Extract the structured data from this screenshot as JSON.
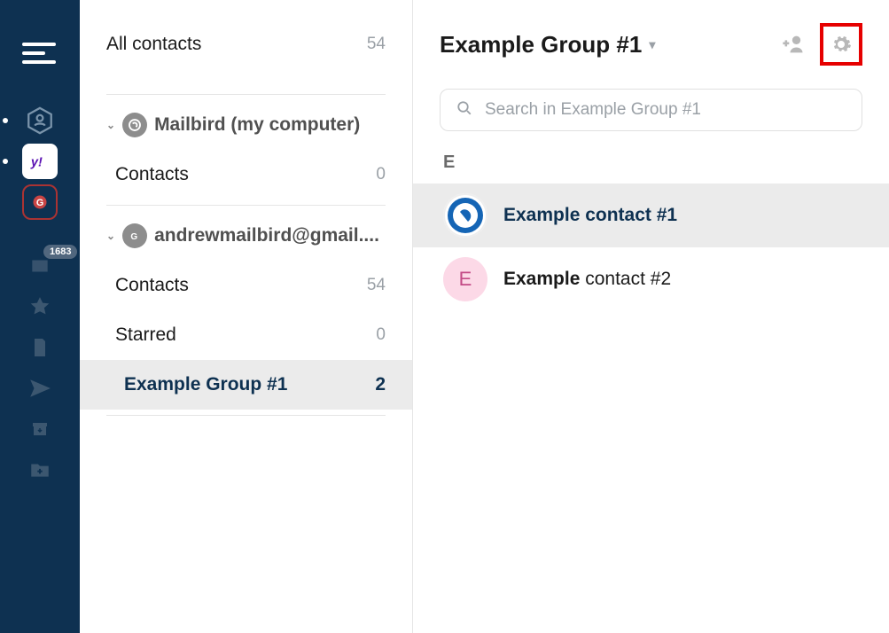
{
  "rail": {
    "badge_count": "1683"
  },
  "sidebar": {
    "all_contacts_label": "All contacts",
    "all_contacts_count": "54",
    "accounts": [
      {
        "name": "Mailbird (my computer)",
        "contacts_label": "Contacts",
        "contacts_count": "0"
      },
      {
        "name": "andrewmailbird@gmail....",
        "contacts_label": "Contacts",
        "contacts_count": "54",
        "starred_label": "Starred",
        "starred_count": "0",
        "group_label": "Example Group #1",
        "group_count": "2"
      }
    ]
  },
  "main": {
    "title": "Example Group #1",
    "search_placeholder": "Search in Example Group #1",
    "section_letter": "E",
    "contacts": [
      {
        "bold": "Example contact #1",
        "rest": "",
        "avatar_letter": ""
      },
      {
        "bold": "Example",
        "rest": " contact #2",
        "avatar_letter": "E"
      }
    ]
  }
}
